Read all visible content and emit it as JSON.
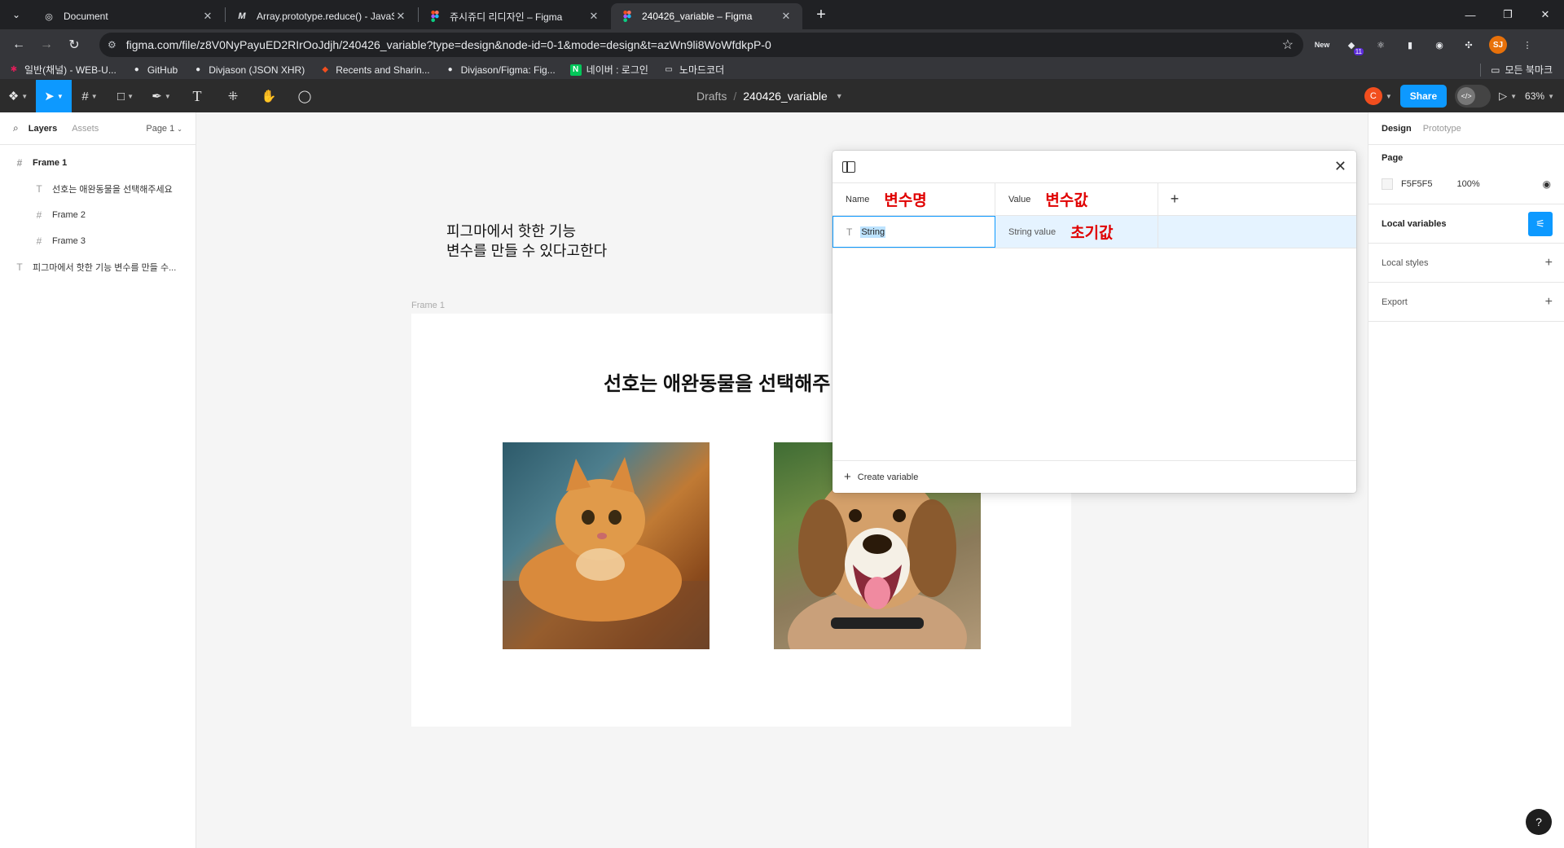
{
  "browser": {
    "tabs": [
      {
        "title": "Document",
        "favicon": "globe-icon"
      },
      {
        "title": "Array.prototype.reduce() - JavaS",
        "favicon": "mdn-icon"
      },
      {
        "title": "쥬시쥬디 리디자인 – Figma",
        "favicon": "figma-icon"
      },
      {
        "title": "240426_variable – Figma",
        "favicon": "figma-icon"
      }
    ],
    "url": "figma.com/file/z8V0NyPayuED2RIrOoJdjh/240426_variable?type=design&node-id=0-1&mode=design&t=azWn9li8WoWfdkpP-0",
    "ext_new_label": "New",
    "ext_badge": "11",
    "profile_initials": "SJ",
    "bookmarks": [
      {
        "label": "일반(채널) - WEB-U...",
        "icon": "slack-icon"
      },
      {
        "label": "GitHub",
        "icon": "github-icon"
      },
      {
        "label": "Divjason (JSON XHR)",
        "icon": "github-icon"
      },
      {
        "label": "Recents and Sharin...",
        "icon": "figma-icon"
      },
      {
        "label": "Divjason/Figma: Fig...",
        "icon": "github-icon"
      },
      {
        "label": "네이버 : 로그인",
        "icon": "naver-icon"
      },
      {
        "label": "노마드코더",
        "icon": "folder-icon"
      }
    ],
    "all_bookmarks": "모든 북마크"
  },
  "toolbar": {
    "breadcrumb_drafts": "Drafts",
    "breadcrumb_slash": "/",
    "file_name": "240426_variable",
    "user_initial": "C",
    "share_label": "Share",
    "zoom": "63%",
    "accent": "#0d99ff"
  },
  "left_panel": {
    "tab_layers": "Layers",
    "tab_assets": "Assets",
    "page_select": "Page 1",
    "layers": [
      {
        "name": "Frame 1",
        "type": "frame",
        "indent": 0
      },
      {
        "name": "선호는 애완동물을 선택해주세요",
        "type": "text",
        "indent": 1
      },
      {
        "name": "Frame 2",
        "type": "frame",
        "indent": 1
      },
      {
        "name": "Frame 3",
        "type": "frame",
        "indent": 1
      },
      {
        "name": "피그마에서 핫한 기능 변수를 만들 수...",
        "type": "text",
        "indent": 0
      }
    ]
  },
  "canvas": {
    "text_line1": "피그마에서 핫한 기능",
    "text_line2": "변수를 만들 수 있다고한다",
    "frame_label": "Frame 1",
    "frame_heading": "선호는 애완동물을 선택해주",
    "background": "#f5f5f5"
  },
  "variables_modal": {
    "col_name": "Name",
    "col_name_annotation": "변수명",
    "col_value": "Value",
    "col_value_annotation": "변수값",
    "row_name": "String",
    "row_value": "String value",
    "row_value_annotation": "초기값",
    "create_label": "Create variable",
    "annotation_color": "#e00000"
  },
  "right_panel": {
    "tab_design": "Design",
    "tab_prototype": "Prototype",
    "page_title": "Page",
    "page_color": "F5F5F5",
    "page_opacity": "100%",
    "local_variables": "Local variables",
    "local_styles": "Local styles",
    "export": "Export",
    "help": "?"
  }
}
